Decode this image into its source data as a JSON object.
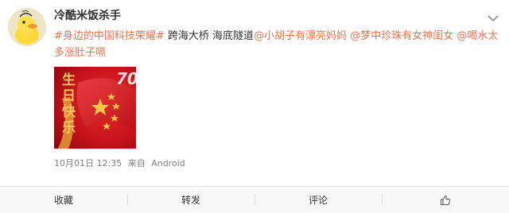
{
  "post": {
    "username": "冷酷米饭杀手",
    "text_segments": [
      {
        "type": "link",
        "name": "topic-link",
        "text": "#身边的中国科技荣耀#"
      },
      {
        "type": "text",
        "name": "body-text",
        "text": " 跨海大桥 海底隧道"
      },
      {
        "type": "link",
        "name": "mention-link",
        "text": "@小胡子有漂亮妈妈"
      },
      {
        "type": "text",
        "name": "separator-text",
        "text": " "
      },
      {
        "type": "link",
        "name": "mention-link",
        "text": "@梦中珍珠有女神闺女"
      },
      {
        "type": "text",
        "name": "separator-text",
        "text": " "
      },
      {
        "type": "link",
        "name": "mention-link",
        "text": "@喝水太多涨肚子嗝"
      }
    ],
    "timestamp": "10月01日 12:35",
    "source_prefix": "来自",
    "source": "Android",
    "image": {
      "icon": "birthday-flag-image",
      "text_chars": [
        "生",
        "日",
        "快",
        "乐"
      ],
      "badge": "70",
      "colors": {
        "background": "#c9161c",
        "text": "#f2c55c"
      }
    }
  },
  "actions": {
    "favorite": "收藏",
    "repost": "转发",
    "comment": "评论",
    "like_icon": "thumbs-up-icon"
  },
  "menu_icon": "chevron-down-icon",
  "colors": {
    "link": "#eb7350",
    "meta": "#808080",
    "action_bar": "#f8f8f8"
  }
}
